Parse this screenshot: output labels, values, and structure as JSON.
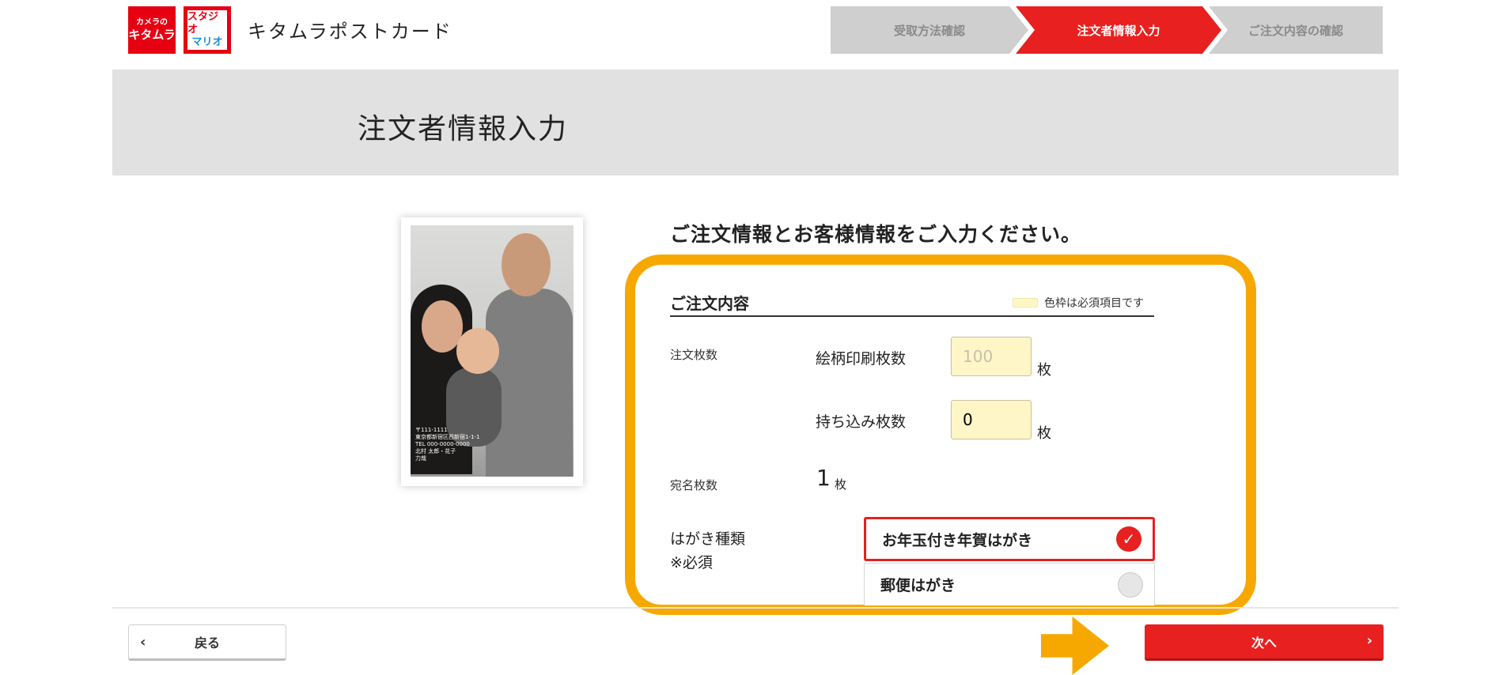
{
  "header": {
    "logo_kitamura_small": "カメラの",
    "logo_kitamura_big": "キタムラ",
    "logo_mario_line1": "スタジオ",
    "logo_mario_line2": "マリオ",
    "site_title": "キタムラポストカード"
  },
  "steps": [
    {
      "label": "受取方法確認",
      "state": "inactive"
    },
    {
      "label": "注文者情報入力",
      "state": "active"
    },
    {
      "label": "ご注文内容の確認",
      "state": "inactive"
    }
  ],
  "banner": {
    "title": "注文者情報入力"
  },
  "photo": {
    "print_text": "〒111-1111\n東京都新宿区西新宿1-1-1\nTEL 000-0000-0000\n北村 太郎・花子\n力哉"
  },
  "main": {
    "heading": "ご注文情報とお客様情報をご入力ください。",
    "section_title": "ご注文内容",
    "legend": "色枠は必須項目です",
    "order_count_label": "注文枚数",
    "design_print_label": "絵柄印刷枚数",
    "design_print_placeholder": "100",
    "bring_in_label": "持ち込み枚数",
    "bring_in_value": "0",
    "unit": "枚",
    "address_count_label": "宛名枚数",
    "address_count_value": "1",
    "card_type_label": "はがき種類",
    "card_type_required": "※必須",
    "options": [
      {
        "label": "お年玉付き年賀はがき",
        "selected": true
      },
      {
        "label": "郵便はがき",
        "selected": false
      }
    ]
  },
  "footer": {
    "back_label": "戻る",
    "next_label": "次へ"
  },
  "colors": {
    "accent_red": "#e8201f",
    "highlight_orange": "#f7a800",
    "required_yellow": "#fff6c8"
  }
}
